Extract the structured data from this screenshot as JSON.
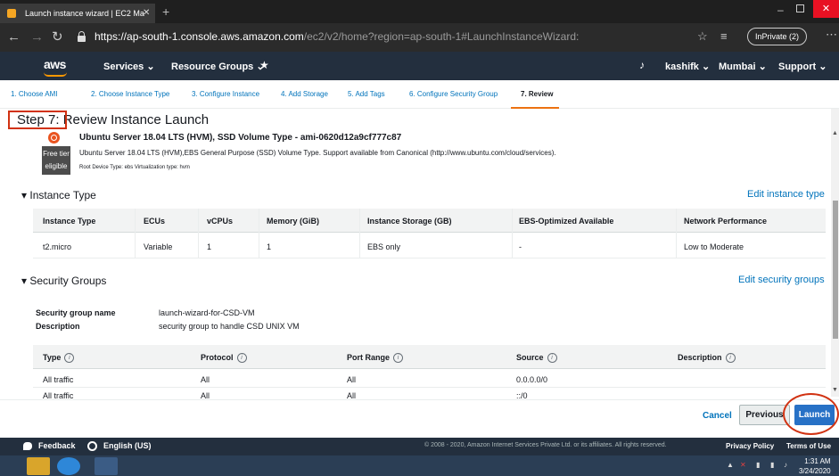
{
  "browser": {
    "tab_title": "Launch instance wizard | EC2 Ma",
    "url_host": "https://ap-south-1.console.aws.amazon.com",
    "url_path": "/ec2/v2/home?region=ap-south-1#LaunchInstanceWizard:",
    "inprivate_label": "InPrivate (2)"
  },
  "aws_header": {
    "logo": "aws",
    "services": "Services ⌄",
    "resource_groups": "Resource Groups ⌄",
    "user": "kashifk ⌄",
    "region": "Mumbai ⌄",
    "support": "Support ⌄"
  },
  "wizard": {
    "steps": [
      {
        "label": "1. Choose AMI"
      },
      {
        "label": "2. Choose Instance Type"
      },
      {
        "label": "3. Configure Instance"
      },
      {
        "label": "4. Add Storage"
      },
      {
        "label": "5. Add Tags"
      },
      {
        "label": "6. Configure Security Group"
      },
      {
        "label": "7. Review"
      }
    ],
    "active_step": "7. Review"
  },
  "review": {
    "title_step": "Step 7:",
    "title_text": " Review Instance Launch",
    "ami_name": "Ubuntu Server 18.04 LTS (HVM), SSD Volume Type - ami-0620d12a9cf777c87",
    "free_tier_line1": "Free tier",
    "free_tier_line2": "eligible",
    "ami_description": "Ubuntu Server 18.04 LTS (HVM),EBS General Purpose (SSD) Volume Type. Support available from Canonical (http://www.ubuntu.com/cloud/services).",
    "ami_meta": "Root Device Type: ebs    Virtualization type: hvm"
  },
  "instance_type_section": {
    "heading": "Instance Type",
    "edit_link": "Edit instance type",
    "columns": [
      "Instance Type",
      "ECUs",
      "vCPUs",
      "Memory (GiB)",
      "Instance Storage (GB)",
      "EBS-Optimized Available",
      "Network Performance"
    ],
    "row": [
      "t2.micro",
      "Variable",
      "1",
      "1",
      "EBS only",
      "-",
      "Low to Moderate"
    ]
  },
  "security_groups_section": {
    "heading": "Security Groups",
    "edit_link": "Edit security groups",
    "name_label": "Security group name",
    "name_value": "launch-wizard-for-CSD-VM",
    "desc_label": "Description",
    "desc_value": "security group to handle CSD UNIX VM",
    "columns": [
      "Type",
      "Protocol",
      "Port Range",
      "Source",
      "Description"
    ],
    "rows": [
      [
        "All traffic",
        "All",
        "All",
        "0.0.0.0/0",
        ""
      ],
      [
        "All traffic",
        "All",
        "All",
        "::/0",
        ""
      ]
    ]
  },
  "actions": {
    "cancel": "Cancel",
    "previous": "Previous",
    "launch": "Launch"
  },
  "aws_footer": {
    "feedback": "Feedback",
    "language": "English (US)",
    "copyright": "© 2008 - 2020, Amazon Internet Services Private Ltd. or its affiliates. All rights reserved.",
    "privacy": "Privacy Policy",
    "terms": "Terms of Use"
  },
  "taskbar": {
    "time": "1:31 AM",
    "date": "3/24/2020"
  }
}
